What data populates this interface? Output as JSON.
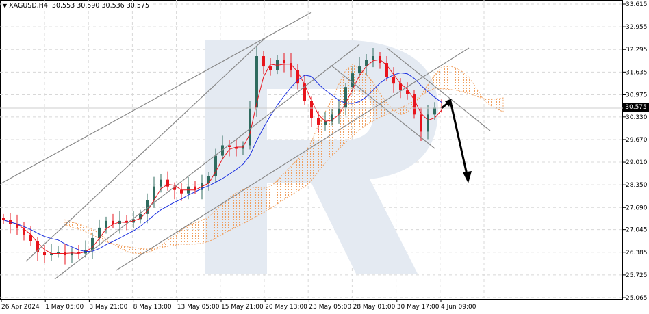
{
  "header": {
    "symbol": "XAGUSD,H4",
    "open": "30.553",
    "high": "30.590",
    "low": "30.536",
    "close": "30.575"
  },
  "current_price": "30.575",
  "colors": {
    "bull": "#2f6b5f",
    "bear": "#e8141c",
    "tenkan": "#e8141c",
    "kijun": "#1a2fe0",
    "cloud_a": "#f0a060",
    "cloud_b": "#c8b8cc",
    "grid": "#d8d8d8",
    "logo": "#e4eaf2"
  },
  "chart_data": {
    "type": "candlestick",
    "title": "XAGUSD,H4",
    "y_ticks": [
      "33.615",
      "32.955",
      "32.295",
      "31.635",
      "30.975",
      "30.330",
      "29.670",
      "29.010",
      "28.350",
      "27.690",
      "27.045",
      "26.385",
      "25.725",
      "25.065"
    ],
    "ylim": [
      25.065,
      33.615
    ],
    "x_ticks": [
      "26 Apr 2024",
      "1 May 05:00",
      "3 May 21:00",
      "8 May 13:00",
      "13 May 05:00",
      "15 May 21:00",
      "20 May 13:00",
      "23 May 05:00",
      "28 May 01:00",
      "30 May 17:00",
      "4 Jun 09:00"
    ],
    "closes": [
      27.33,
      27.2,
      27.1,
      26.9,
      26.7,
      26.4,
      26.3,
      26.35,
      26.4,
      26.3,
      26.4,
      26.35,
      26.45,
      26.8,
      27.1,
      27.3,
      27.2,
      27.3,
      27.25,
      27.35,
      27.5,
      27.9,
      28.3,
      28.5,
      28.3,
      28.2,
      28.1,
      28.3,
      28.2,
      28.4,
      28.6,
      29.2,
      29.5,
      29.45,
      29.4,
      29.5,
      30.6,
      32.1,
      31.8,
      31.7,
      32.0,
      31.9,
      31.7,
      31.3,
      30.8,
      30.3,
      30.1,
      30.2,
      30.4,
      30.6,
      31.2,
      31.6,
      31.8,
      32.0,
      32.1,
      31.9,
      31.5,
      31.3,
      31.1,
      31.0,
      30.4,
      29.9,
      30.4,
      30.6,
      30.575
    ],
    "forecast_target": 28.35
  }
}
